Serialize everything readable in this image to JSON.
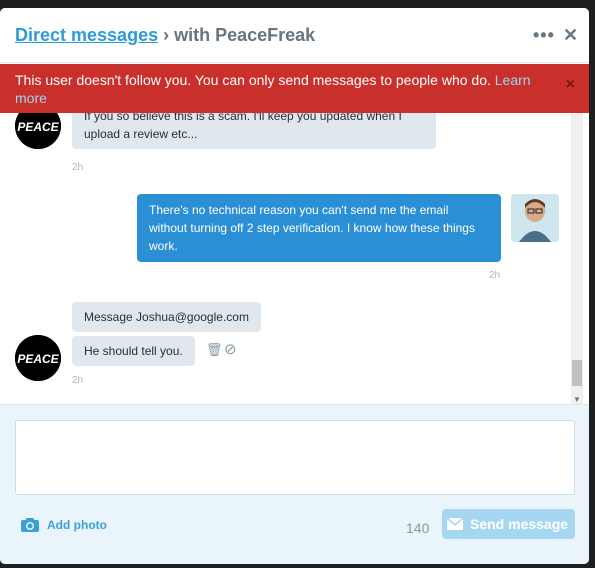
{
  "header": {
    "link_label": "Direct messages",
    "separator": " › ",
    "title": "with PeaceFreak",
    "more_icon": "more-icon",
    "close_icon": "close-icon"
  },
  "alert": {
    "text": "This user doesn't follow you. You can only send messages to people who do. ",
    "link": "Learn more",
    "close": "×"
  },
  "messages": [
    {
      "from": "PeaceFreak",
      "text": "If you so believe this is a scam. I'll keep you updated when I upload a review etc...",
      "time": "2h"
    },
    {
      "from": "me",
      "text": "There's no technical reason you can't send me the email without turning off 2 step verification. I know how these things work.",
      "time": "2h"
    },
    {
      "from": "PeaceFreak",
      "text": "Message Joshua@google.com",
      "time": ""
    },
    {
      "from": "PeaceFreak",
      "text": "He should tell you.",
      "time": "2h"
    }
  ],
  "avatar_text": "PEACE",
  "composer": {
    "add_photo_label": "Add photo",
    "char_count": "140",
    "send_label": "Send message"
  },
  "colors": {
    "accent": "#2b9cd8",
    "alert": "#c9302c",
    "my_bubble": "#2b8fd6",
    "their_bubble": "#e1e8ed",
    "send_disabled": "#a6d7f2"
  }
}
